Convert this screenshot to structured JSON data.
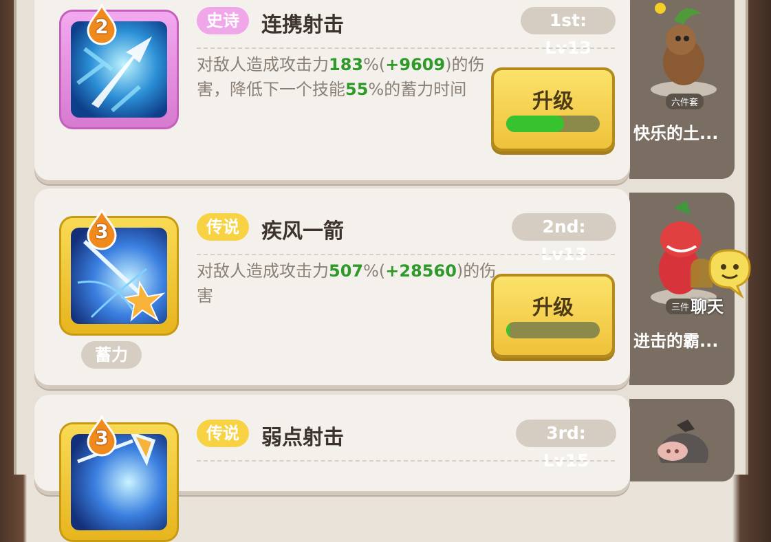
{
  "skills": [
    {
      "slot": "2",
      "rarity": "史诗",
      "name": "连携射击",
      "rank": "1st: Lv13",
      "desc_parts": [
        "对敌人造成攻击力",
        "183",
        "%(",
        "+9609",
        ")的伤害，降低下一个技能",
        "55",
        "%的蓄力时间"
      ],
      "upgrade_label": "升级",
      "progress": 0.62,
      "colors": {
        "frame": "#e78be0",
        "tag_bg": "#f0a7ea",
        "tag_text": "#ffffff"
      }
    },
    {
      "slot": "3",
      "rarity": "传说",
      "name": "疾风一箭",
      "rank": "2nd: Lv13",
      "desc_parts": [
        "对敌人造成攻击力",
        "507",
        "%(",
        "+28560",
        ")的伤害"
      ],
      "upgrade_label": "升级",
      "progress": 0.04,
      "charge_label": "蓄力",
      "colors": {
        "frame": "#f4c630",
        "tag_bg": "#f7d344",
        "tag_text": "#ffffff"
      }
    },
    {
      "slot": "3",
      "rarity": "传说",
      "name": "弱点射击",
      "rank": "3rd: Lv15",
      "colors": {
        "frame": "#f4c630",
        "tag_bg": "#f7d344",
        "tag_text": "#ffffff"
      }
    }
  ],
  "sets": [
    {
      "badge": "六件套",
      "name": "快乐的土..."
    },
    {
      "badge": "三件",
      "name": "进击的霸..."
    }
  ],
  "chat_label": "聊天"
}
